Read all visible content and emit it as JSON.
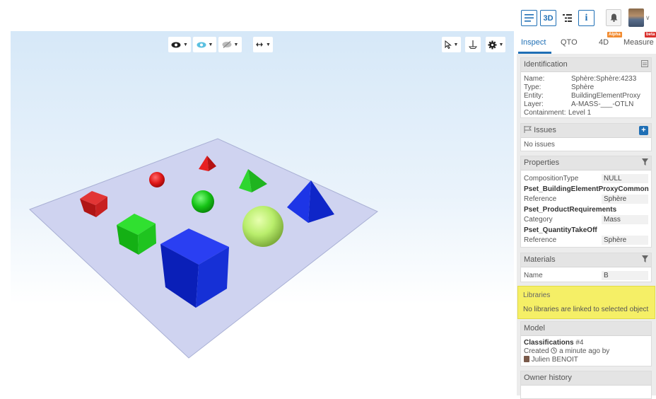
{
  "toolbar": {
    "view_3d_label": "3D",
    "info_label": "i"
  },
  "viewer": {
    "background_top": "#d6e8f8",
    "plane_color": "#cfd3f0",
    "objects": [
      "red cube",
      "red sphere",
      "red pyramid",
      "green pyramid",
      "green sphere",
      "green cube",
      "blue cube",
      "light green sphere",
      "blue pyramid"
    ]
  },
  "panel": {
    "tabs": [
      {
        "label": "Inspect",
        "active": true
      },
      {
        "label": "QTO"
      },
      {
        "label": "4D",
        "badge": "Alpha"
      },
      {
        "label": "Measure",
        "badge": "beta"
      }
    ],
    "identification": {
      "title": "Identification",
      "rows": [
        {
          "key": "Name:",
          "value": "Sphère:Sphère:4233"
        },
        {
          "key": "Type:",
          "value": "Sphère"
        },
        {
          "key": "Entity:",
          "value": "BuildingElementProxy"
        },
        {
          "key": "Layer:",
          "value": "A-MASS-___-OTLN"
        },
        {
          "key": "Containment:",
          "value": "Level 1"
        }
      ]
    },
    "issues": {
      "title": "Issues",
      "empty_text": "No issues"
    },
    "properties": {
      "title": "Properties",
      "composition_key": "CompositionType",
      "composition_value": "NULL",
      "pset1": "Pset_BuildingElementProxyCommon",
      "pset1_key": "Reference",
      "pset1_value": "Sphère",
      "pset2": "Pset_ProductRequirements",
      "pset2_key": "Category",
      "pset2_value": "Mass",
      "pset3": "Pset_QuantityTakeOff",
      "pset3_key": "Reference",
      "pset3_value": "Sphère"
    },
    "materials": {
      "title": "Materials",
      "key": "Name",
      "value": "B"
    },
    "libraries": {
      "title": "Libraries",
      "message": "No libraries are linked to selected object",
      "highlight": "#f5ef66"
    },
    "model": {
      "title": "Model",
      "name": "Classifications",
      "number": "#4",
      "created_prefix": "Created",
      "created_time": "a minute ago by",
      "author": "Julien BENOIT"
    },
    "owner_history": {
      "title": "Owner history"
    }
  }
}
